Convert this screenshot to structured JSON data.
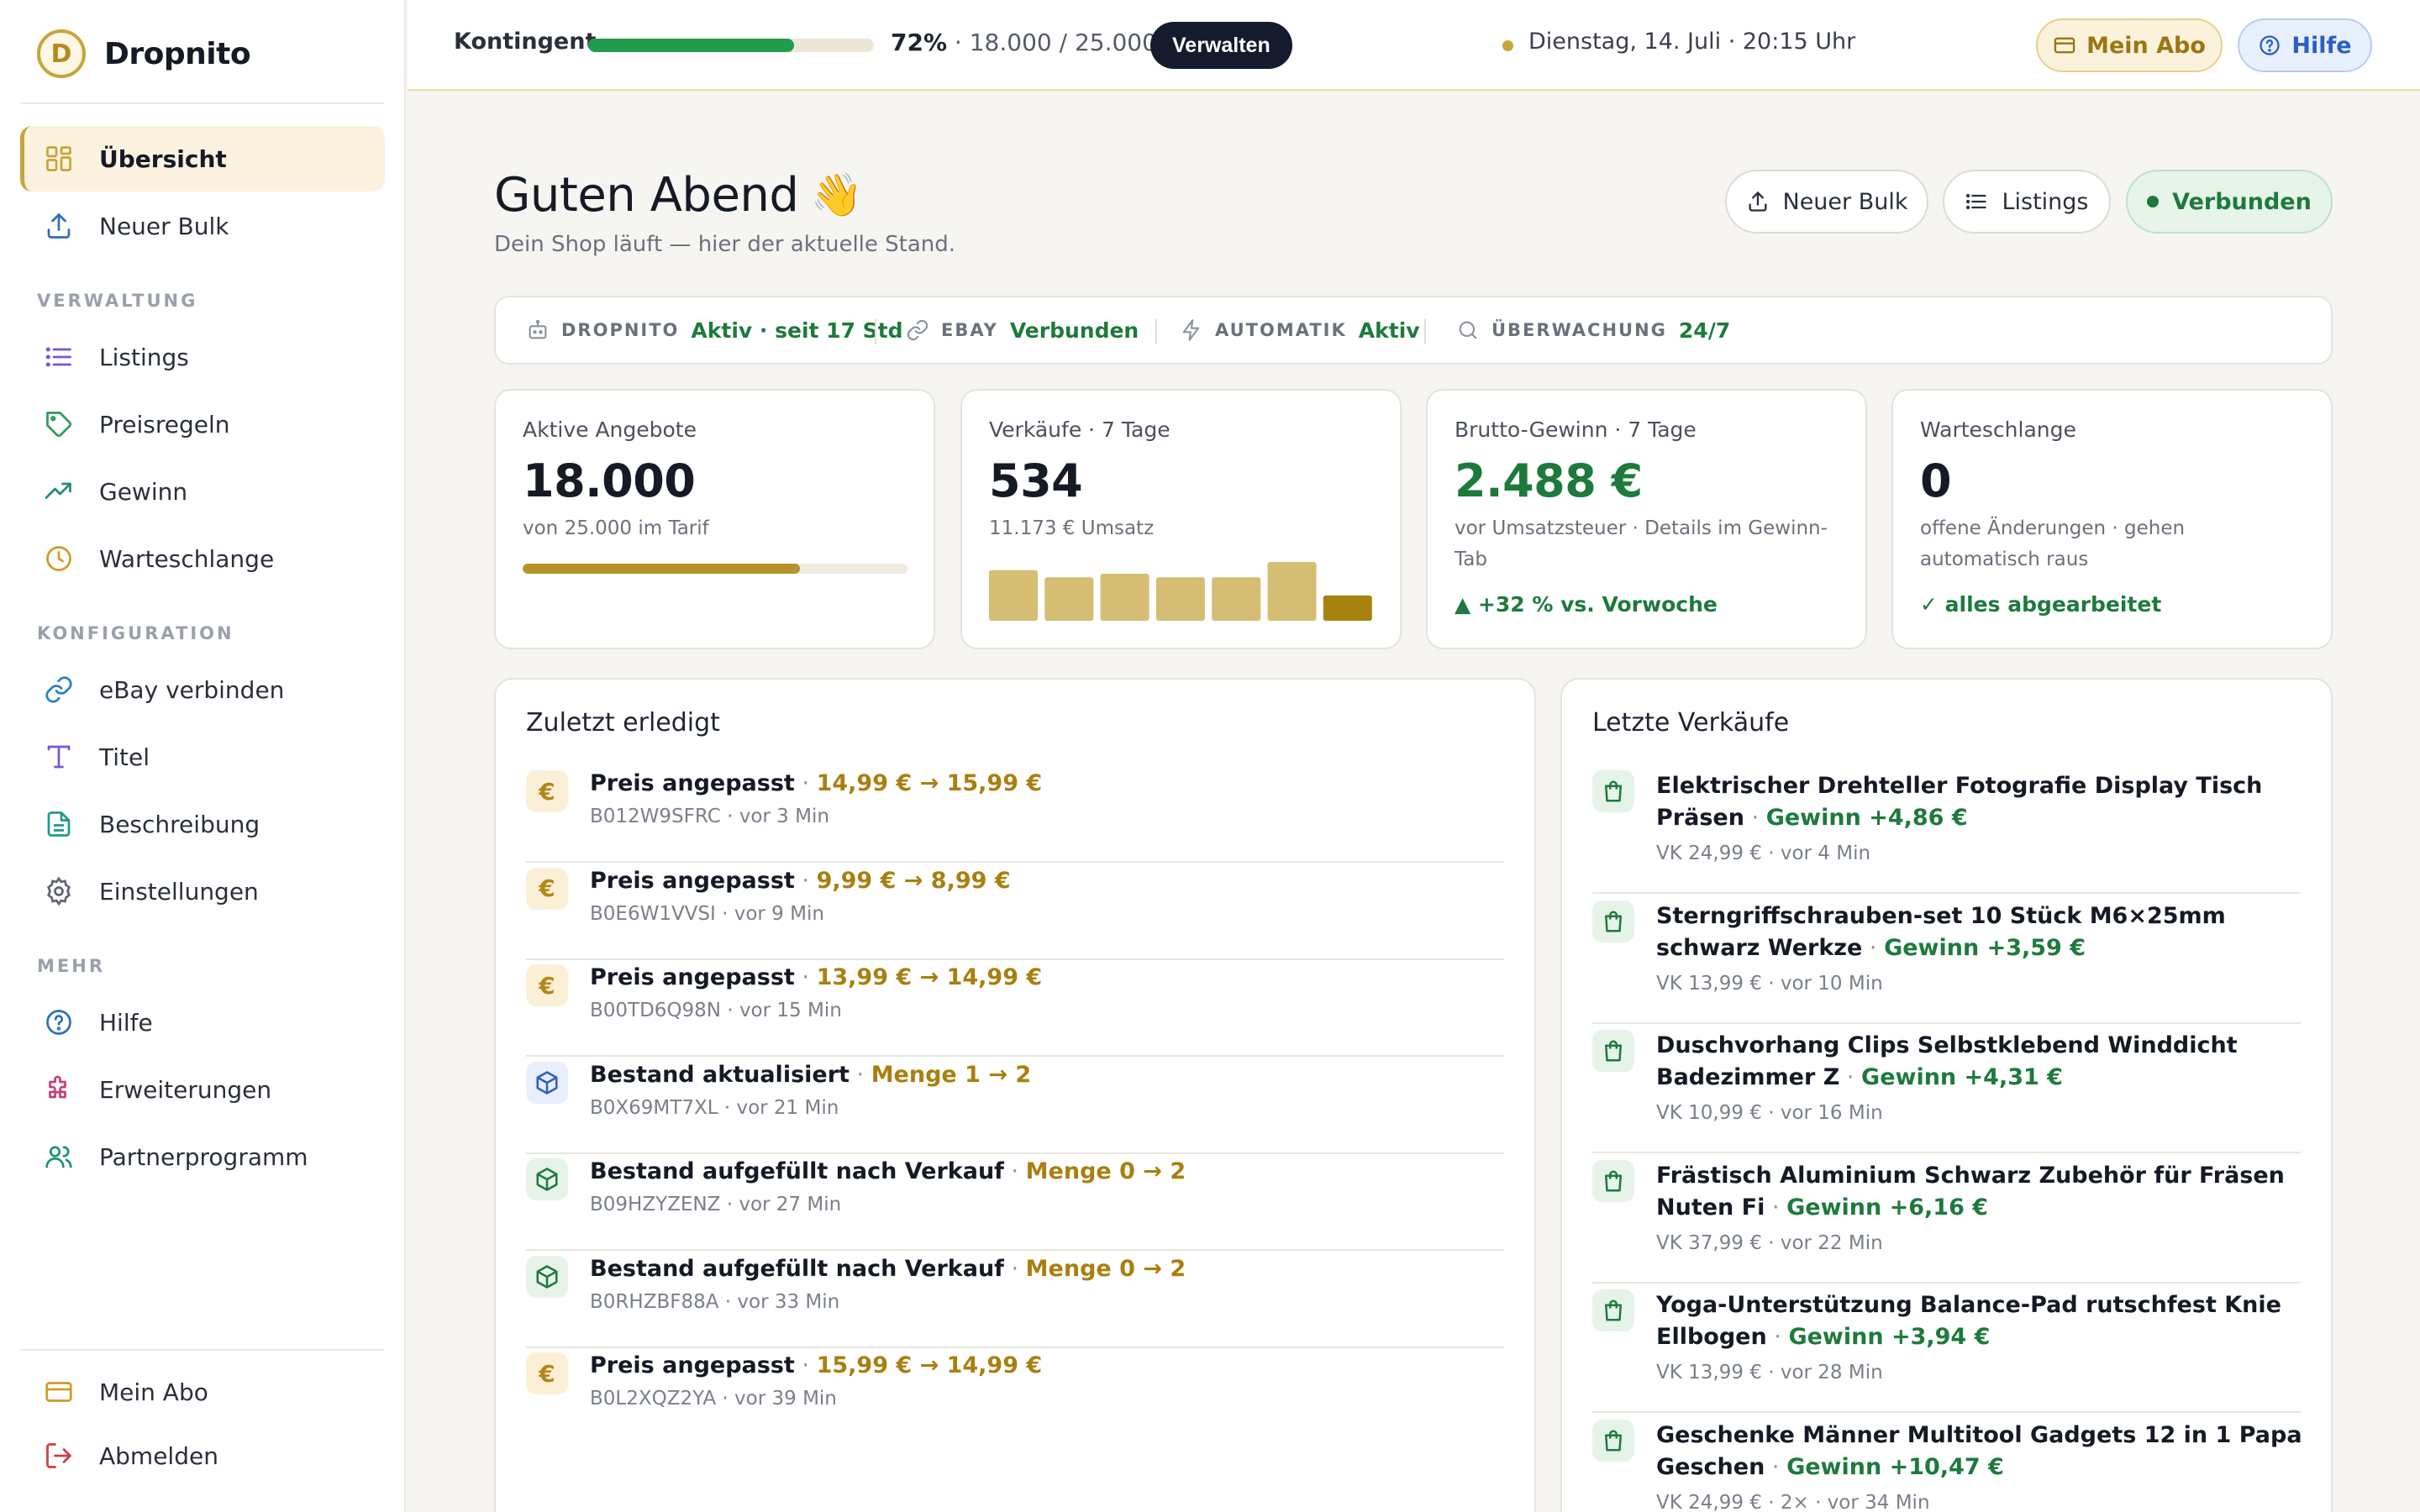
{
  "brand": {
    "logo_letter": "D",
    "name": "Dropnito"
  },
  "sidebar": {
    "main": [
      {
        "label": "Übersicht",
        "icon": "grid-icon",
        "active": true
      },
      {
        "label": "Neuer Bulk",
        "icon": "upload-icon"
      }
    ],
    "section_verwaltung": "VERWALTUNG",
    "verwaltung": [
      {
        "label": "Listings",
        "icon": "list-icon"
      },
      {
        "label": "Preisregeln",
        "icon": "tag-icon"
      },
      {
        "label": "Gewinn",
        "icon": "trending-up-icon"
      },
      {
        "label": "Warteschlange",
        "icon": "clock-icon"
      }
    ],
    "section_konfiguration": "KONFIGURATION",
    "konfiguration": [
      {
        "label": "eBay verbinden",
        "icon": "link-icon"
      },
      {
        "label": "Titel",
        "icon": "type-icon"
      },
      {
        "label": "Beschreibung",
        "icon": "document-icon"
      },
      {
        "label": "Einstellungen",
        "icon": "gear-icon"
      }
    ],
    "section_mehr": "MEHR",
    "mehr": [
      {
        "label": "Hilfe",
        "icon": "help-circle-icon"
      },
      {
        "label": "Erweiterungen",
        "icon": "puzzle-icon"
      },
      {
        "label": "Partnerprogramm",
        "icon": "users-icon"
      }
    ],
    "bottom": [
      {
        "label": "Mein Abo",
        "icon": "credit-card-icon"
      },
      {
        "label": "Abmelden",
        "icon": "logout-icon"
      }
    ]
  },
  "topbar": {
    "quota_label": "Kontingent",
    "quota_fraction": 0.72,
    "quota_percent": "72%",
    "quota_detail": " · 18.000 / 25.000",
    "manage_button": "Verwalten",
    "date_text": "Dienstag, 14. Juli · 20:15 Uhr",
    "abo_button": "Mein Abo",
    "help_button": "Hilfe"
  },
  "header": {
    "greeting": "Guten Abend",
    "wave": "👋",
    "subtitle": "Dein Shop läuft — hier der aktuelle Stand.",
    "btn_bulk": "Neuer Bulk",
    "btn_listings": "Listings",
    "btn_connected": "Verbunden"
  },
  "status": [
    {
      "key": "DROPNITO",
      "value": "Aktiv · seit 17 Std",
      "icon": "robot-icon"
    },
    {
      "key": "EBAY",
      "value": "Verbunden",
      "icon": "link-icon"
    },
    {
      "key": "AUTOMATIK",
      "value": "Aktiv",
      "icon": "bolt-icon"
    },
    {
      "key": "ÜBERWACHUNG",
      "value": "24/7",
      "icon": "search-icon"
    }
  ],
  "cards": {
    "active": {
      "title": "Aktive Angebote",
      "value": "18.000",
      "sub": "von 25.000 im Tarif",
      "fraction": 0.72
    },
    "sales": {
      "title": "Verkäufe · 7 Tage",
      "value": "534",
      "sub": "11.173 € Umsatz",
      "bars": [
        0.86,
        0.74,
        0.8,
        0.74,
        0.74,
        1.0,
        0.43
      ]
    },
    "profit": {
      "title": "Brutto-Gewinn · 7 Tage",
      "value": "2.488 €",
      "sub": "vor Umsatzsteuer · Details im Gewinn-Tab",
      "trend": "▲ +32 % vs. Vorwoche"
    },
    "queue": {
      "title": "Warteschlange",
      "value": "0",
      "sub": "offene Änderungen · gehen automatisch raus",
      "done": "✓ alles abgearbeitet"
    }
  },
  "recent": {
    "title": "Zuletzt erledigt",
    "items": [
      {
        "type": "price",
        "action": "Preis angepasst",
        "change": "14,99 € → 15,99 €",
        "meta": "B012W9SFRC · vor 3 Min"
      },
      {
        "type": "price",
        "action": "Preis angepasst",
        "change": "9,99 € → 8,99 €",
        "meta": "B0E6W1VVSI · vor 9 Min"
      },
      {
        "type": "price",
        "action": "Preis angepasst",
        "change": "13,99 € → 14,99 €",
        "meta": "B00TD6Q98N · vor 15 Min"
      },
      {
        "type": "stock",
        "action": "Bestand aktualisiert",
        "change": "Menge 1 → 2",
        "meta": "B0X69MT7XL · vor 21 Min"
      },
      {
        "type": "refill",
        "action": "Bestand aufgefüllt nach Verkauf",
        "change": "Menge 0 → 2",
        "meta": "B09HZYZENZ · vor 27 Min"
      },
      {
        "type": "refill",
        "action": "Bestand aufgefüllt nach Verkauf",
        "change": "Menge 0 → 2",
        "meta": "B0RHZBF88A · vor 33 Min"
      },
      {
        "type": "price",
        "action": "Preis angepasst",
        "change": "15,99 € → 14,99 €",
        "meta": "B0L2XQZ2YA · vor 39 Min"
      }
    ]
  },
  "sales_list": {
    "title": "Letzte Verkäufe",
    "items": [
      {
        "name": "Elektrischer Drehteller Fotografie Display Tisch Präsen",
        "profit": "Gewinn +4,86 €",
        "meta": "VK 24,99 € · vor 4 Min"
      },
      {
        "name": "Sterngriffschrauben-set 10 Stück M6×25mm schwarz Werkze",
        "profit": "Gewinn +3,59 €",
        "meta": "VK 13,99 € · vor 10 Min"
      },
      {
        "name": "Duschvorhang Clips Selbstklebend Winddicht Badezimmer Z",
        "profit": "Gewinn +4,31 €",
        "meta": "VK 10,99 € · vor 16 Min"
      },
      {
        "name": "Frästisch Aluminium Schwarz Zubehör für Fräsen Nuten Fi",
        "profit": "Gewinn +6,16 €",
        "meta": "VK 37,99 € · vor 22 Min"
      },
      {
        "name": "Yoga-Unterstützung Balance-Pad rutschfest Knie Ellbogen",
        "profit": "Gewinn +3,94 €",
        "meta": "VK 13,99 € · vor 28 Min"
      },
      {
        "name": "Geschenke Männer Multitool Gadgets 12 in 1 Papa Geschen",
        "profit": "Gewinn +10,47 €",
        "meta": "VK 24,99 € · 2× · vor 34 Min"
      }
    ]
  },
  "colors": {
    "gold": "#c8a43a",
    "green": "#1e7a3c",
    "dark": "#141b2d",
    "blue": "#2b5fc4"
  }
}
